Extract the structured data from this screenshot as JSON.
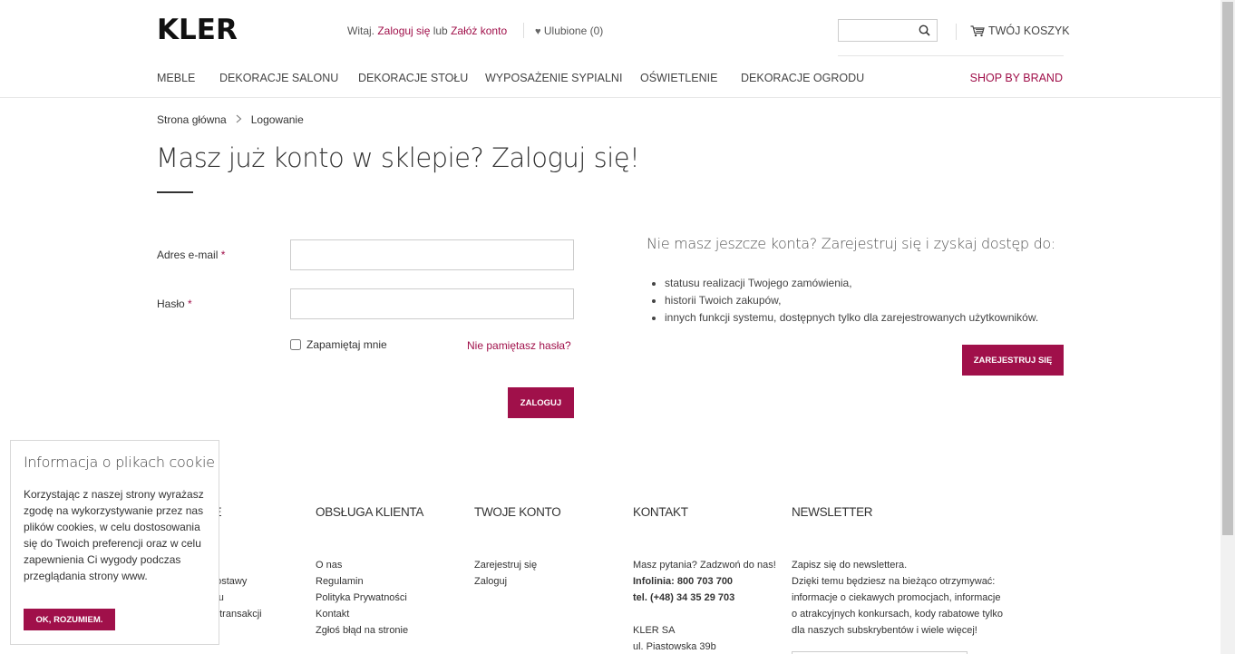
{
  "header": {
    "logo": "KLER",
    "welcome_prefix": "Witaj.",
    "login_link": "Zaloguj się",
    "or_text": "lub",
    "register_link": "Załóż konto",
    "favorites": "Ulubione (0)",
    "search_placeholder": "",
    "cart": "TWÓJ KOSZYK"
  },
  "nav": {
    "items": [
      "MEBLE",
      "DEKORACJE SALONU",
      "DEKORACJE STOŁU",
      "WYPOSAŻENIE SYPIALNI",
      "OŚWIETLENIE",
      "DEKORACJE OGRODU"
    ],
    "brand": "SHOP BY BRAND"
  },
  "breadcrumb": {
    "home": "Strona główna",
    "current": "Logowanie"
  },
  "page_title": "Masz już konto w sklepie? Zaloguj się!",
  "login_form": {
    "email_label": "Adres e-mail",
    "password_label": "Hasło",
    "required_mark": "*",
    "email_value": "",
    "password_value": "",
    "remember_label": "Zapamiętaj mnie",
    "remember_checked": false,
    "forgot_link": "Nie pamiętasz hasła?",
    "submit_label": "ZALOGUJ"
  },
  "register": {
    "heading": "Nie masz jeszcze konta? Zarejestruj się i zyskaj dostęp do:",
    "benefits": [
      "statusu realizacji Twojego zamówienia,",
      "historii Twoich zakupów,",
      "innych funkcji systemu, dostępnych tylko dla zarejestrowanych użytkowników."
    ],
    "button_label": "ZAREJESTRUJ SIĘ"
  },
  "footer": {
    "col1": {
      "title": "JE",
      "items": [
        "ci",
        "i i dostawy",
        "kupu",
        "wo transakcji"
      ]
    },
    "customer_service": {
      "title": "OBSŁUGA KLIENTA",
      "items": [
        "O nas",
        "Regulamin",
        "Polityka Prywatności",
        "Kontakt",
        "Zgłoś błąd na stronie"
      ]
    },
    "account": {
      "title": "TWOJE KONTO",
      "items": [
        "Zarejestruj się",
        "Zaloguj"
      ]
    },
    "contact": {
      "title": "KONTAKT",
      "question": "Masz pytania? Zadzwoń do nas!",
      "infoline": "Infolinia: 800 703 700",
      "phone": "tel. (+48) 34 35 29 703",
      "company": "KLER SA",
      "street": "ul. Piastowska 39b"
    },
    "newsletter": {
      "title": "NEWSLETTER",
      "lines": [
        "Zapisz się do newslettera.",
        "Dzięki temu będziesz na bieżąco otrzymywać:",
        "informacje o ciekawych promocjach, informacje",
        "o atrakcyjnych konkursach, kody rabatowe tylko",
        "dla naszych subskrybentów i wiele więcej!"
      ]
    }
  },
  "cookie": {
    "title": "Informacja o plikach cookie",
    "text": "Korzystając z naszej strony wyrażasz zgodę na wykorzystywanie przez nas plików cookies, w celu dostosowania się do Twoich preferencji oraz w celu zapewnienia Ci wygody podczas przeglądania strony www.",
    "button_label": "OK, ROZUMIEM."
  },
  "colors": {
    "accent": "#a0104a",
    "text": "#333333"
  }
}
